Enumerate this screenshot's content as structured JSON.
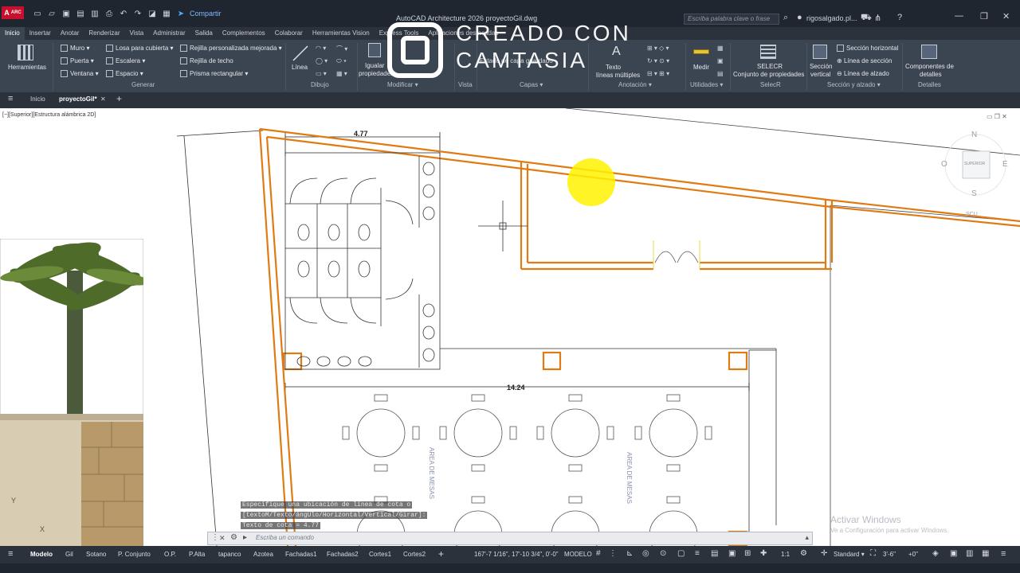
{
  "titlebar": {
    "app_badge": "A",
    "share_label": "Compartir",
    "title": "AutoCAD Architecture 2026   proyectoGil.dwg",
    "search_placeholder": "Escriba palabra clave o frase",
    "user": "rigosalgado.pl..."
  },
  "ribbon_tabs": [
    "Inicio",
    "Insertar",
    "Anotar",
    "Renderizar",
    "Vista",
    "Administrar",
    "Salida",
    "Complementos",
    "Colaborar",
    "Herramientas Vision",
    "Express Tools",
    "Aplicaciones destacadas"
  ],
  "ribbon": {
    "tools_label": "Herramientas",
    "generar": {
      "muro": "Muro",
      "puerta": "Puerta",
      "ventana": "Ventana",
      "losa": "Losa para cubierta",
      "escalera": "Escalera",
      "espacio": "Espacio",
      "rejilla_pers": "Rejilla personalizada mejorada",
      "rejilla_techo": "Rejilla de techo",
      "prisma": "Prisma rectangular",
      "panel": "Generar"
    },
    "dibujo": {
      "linea": "Línea",
      "panel": "Dibujo"
    },
    "modificar": {
      "igualar": "Igualar",
      "propiedades": "propiedades",
      "panel": "Modificar"
    },
    "vista": {
      "panel": "Vista"
    },
    "capas": {
      "estado": "Estado de capa",
      "guardado": "guardado",
      "panel": "Capas"
    },
    "anotacion": {
      "texto": "Texto",
      "lineas": "líneas múltiples",
      "panel": "Anotación"
    },
    "utilidades": {
      "medir": "Medir",
      "panel": "Utilidades"
    },
    "selecr": {
      "top": "SELECR",
      "sub": "Conjunto de propiedades",
      "panel": "SelecR"
    },
    "seccion": {
      "vertical": "Sección",
      "vertical2": "vertical",
      "horizontal": "Sección horizontal",
      "linea_seccion": "Línea de sección",
      "linea_alzado": "Línea de alzado",
      "panel": "Sección y alzado"
    },
    "detalles": {
      "top": "Componentes de",
      "sub": "detalles",
      "panel": "Detalles"
    }
  },
  "doc_tabs": {
    "home": "Inicio",
    "active": "proyectoGil*"
  },
  "viewport_label": "[−][Superior][Estructura alámbrica 2D]",
  "watermark": {
    "line1": "CREADO CON",
    "line2": "CAMTASIA"
  },
  "drawing": {
    "dim_top": "4.77",
    "dim_width": "14.24",
    "area1": "AREA DE MESAS",
    "area2": "AREA DE MESAS",
    "viewcube": {
      "n": "N",
      "s": "S",
      "e": "E",
      "o": "O",
      "face": "SUPERIOR",
      "scu": "SCU"
    }
  },
  "command": {
    "history": [
      "Especifique una ubicación de línea de cota o",
      "[textoM/Texto/ángUlo/Horizontal/Vertical/Girar]:",
      "Texto de cota = 4.77"
    ],
    "placeholder": "Escriba un comando"
  },
  "activate": {
    "title": "Activar Windows",
    "subtitle": "Ve a Configuración para activar Windows."
  },
  "layouts": [
    "Modelo",
    "Gil",
    "Sotano",
    "P. Conjunto",
    "O.P.",
    "P.Alta",
    "tapanco",
    "Azotea",
    "Fachadas1",
    "Fachadas2",
    "Cortes1",
    "Cortes2"
  ],
  "status": {
    "coords": "167'-7 1/16\", 17'-10 3/4\", 0'-0\"",
    "mode": "MODELO",
    "scale": "1:1",
    "style": "Standard",
    "elevation": "3'-6\"",
    "offset": "+0\""
  },
  "colors": {
    "wall": "#e07b14",
    "ui_dark": "#2b323c",
    "ribbon": "#3b4451",
    "highlight": "#fff200"
  }
}
